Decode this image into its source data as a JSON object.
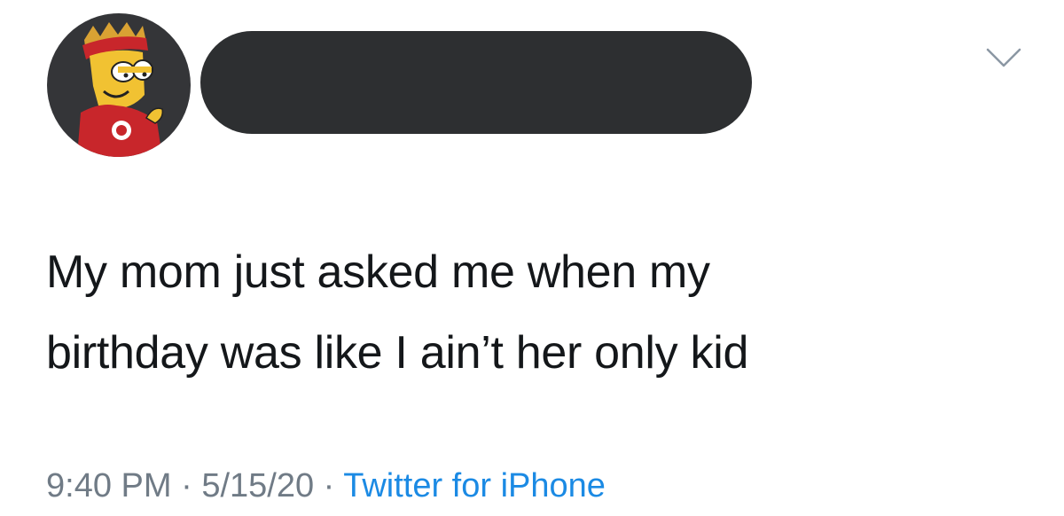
{
  "tweet": {
    "text_lines": [
      "My mom just asked me when my",
      "birthday was like I ain’t her only kid"
    ],
    "time": "9:40 PM",
    "date": "5/15/20",
    "separator": "·",
    "source": "Twitter for iPhone"
  },
  "icons": {
    "avatar": "cartoon-profile-avatar",
    "caret": "chevron-down-icon"
  },
  "colors": {
    "text": "#14171a",
    "meta": "#707b86",
    "link": "#1b8ae4",
    "redaction": "#2d2f31",
    "avatar_bg": "#343538"
  }
}
